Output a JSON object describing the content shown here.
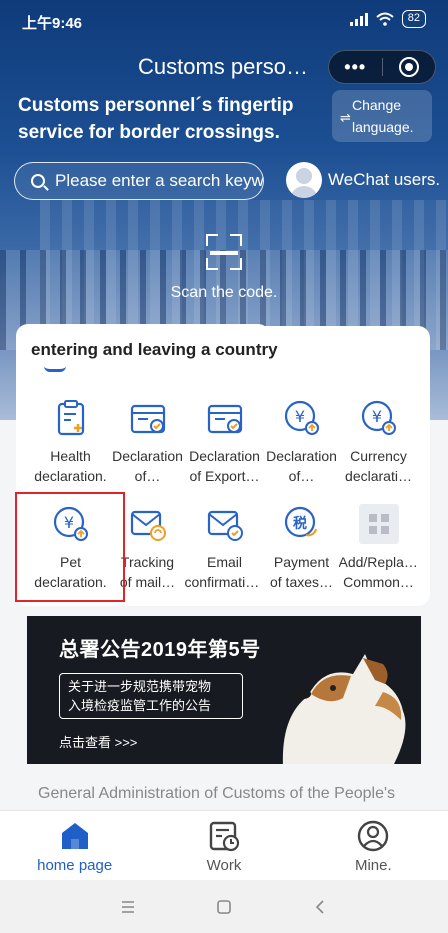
{
  "status": {
    "time": "上午9:46",
    "battery": "82"
  },
  "nav": {
    "title": "Customs perso…",
    "more": "•••"
  },
  "hero": {
    "slogan_line1": "Customs personnel´s fingertip",
    "slogan_line2": "service for border crossings.",
    "lang_line1": "Change",
    "lang_line2": "language.",
    "search_placeholder": "Please enter a search keyw",
    "wechat_label": "WeChat users.",
    "scan_label": "Scan the code."
  },
  "section": {
    "tab_label": "entering and leaving a country"
  },
  "services": [
    {
      "l1": "Health",
      "l2": "declaration."
    },
    {
      "l1": "Declaration",
      "l2": "of…"
    },
    {
      "l1": "Declaration",
      "l2": "of Export…"
    },
    {
      "l1": "Declaration",
      "l2": "of…"
    },
    {
      "l1": "Currency",
      "l2": "declarati…"
    },
    {
      "l1": "Pet",
      "l2": "declaration."
    },
    {
      "l1": "Tracking",
      "l2": "of mail…"
    },
    {
      "l1": "Email",
      "l2": "confirmation."
    },
    {
      "l1": "Payment",
      "l2": "of taxes…"
    },
    {
      "l1": "Add/Replace",
      "l2": "Common…"
    }
  ],
  "icon_names": [
    "clipboard-plus-icon",
    "box-check-icon",
    "box-check-icon",
    "yuan-coin-icon",
    "yuan-coin-icon",
    "yuan-coin-icon",
    "mail-refresh-icon",
    "mail-check-icon",
    "tax-icon",
    "grid-icon"
  ],
  "banner": {
    "title": "总署公告2019年第5号",
    "box_line1": "关于进一步规范携带宠物",
    "box_line2": "入境检疫监管工作的公告",
    "link": "点击查看 >>>"
  },
  "footer": {
    "text": "General Administration of Customs of the People's"
  },
  "tabbar": {
    "home": "home page",
    "work": "Work",
    "mine": "Mine."
  },
  "colors": {
    "accent": "#1f5fc7",
    "icon_blue": "#2a63c8",
    "highlight": "#e0242a",
    "icon_orange": "#f0a020"
  }
}
